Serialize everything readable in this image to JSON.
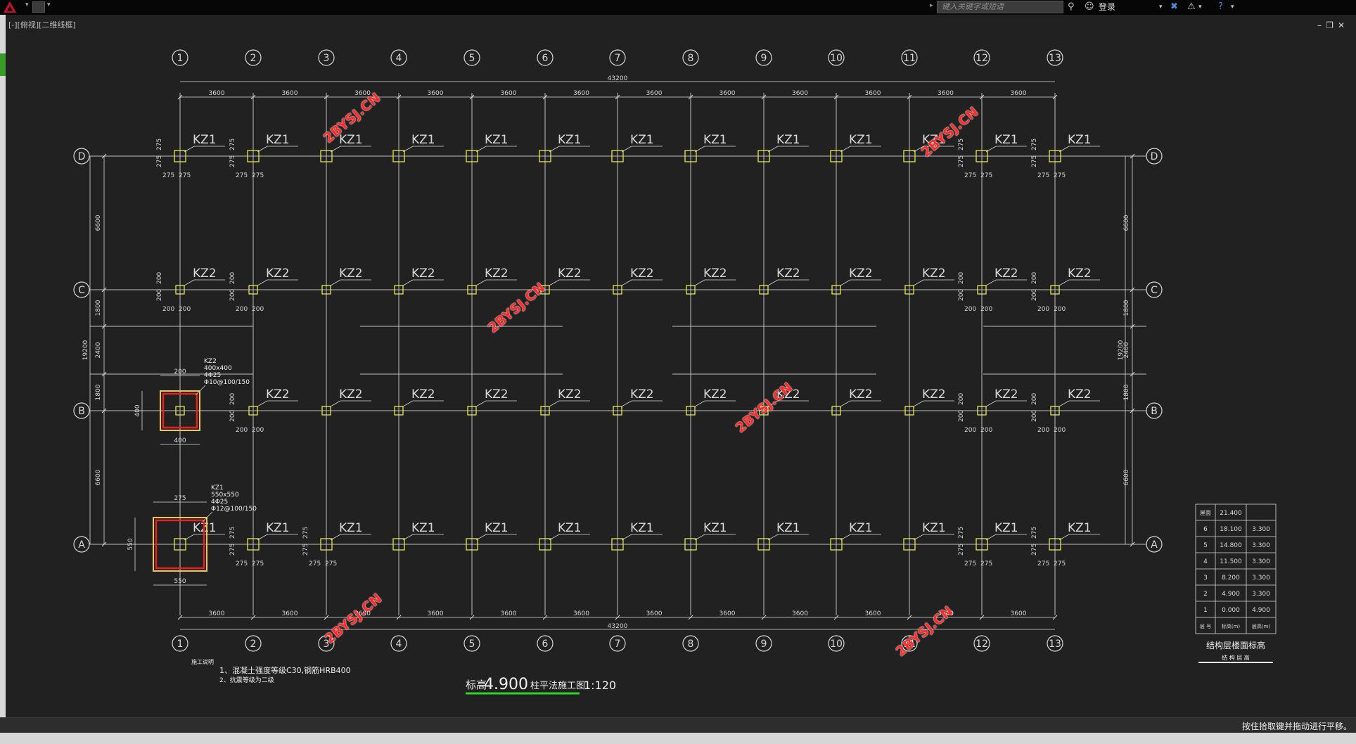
{
  "toolbar": {
    "search_placeholder": "键入关键字或短语",
    "login_label": "登录"
  },
  "viewport": {
    "label": "[-][俯视][二维线框]"
  },
  "status": {
    "message": "按住拾取键并拖动进行平移。"
  },
  "drawing": {
    "columns": [
      "1",
      "2",
      "3",
      "4",
      "5",
      "6",
      "7",
      "8",
      "9",
      "10",
      "11",
      "12",
      "13"
    ],
    "rows": [
      "D",
      "C",
      "B",
      "A"
    ],
    "total_span": "43200",
    "bay_top": [
      "3600",
      "3600",
      "3600",
      "3600",
      "3600",
      "3600",
      "3600",
      "3600",
      "3600",
      "3600",
      "3600",
      "3600"
    ],
    "bay_bottom": [
      "3600",
      "3600",
      "3600",
      "3600",
      "3600",
      "3600",
      "3600",
      "3600",
      "3600",
      "3600",
      "3600",
      "3600"
    ],
    "row_dims_left": [
      "6600",
      "1800",
      "2400",
      "1800",
      "6600"
    ],
    "total_depth": "19200",
    "kz1_label": "KZ1",
    "kz2_label": "KZ2",
    "offset_275": "275",
    "offset_200": "200",
    "detail_kz2": {
      "name": "KZ2",
      "size": "400x400",
      "rebar": "4Φ25",
      "stirrup": "Φ10@100/150",
      "dim_top": "200",
      "dim_side": "400",
      "dim_bottom": "400"
    },
    "detail_kz1": {
      "name": "KZ1",
      "size": "550x550",
      "rebar": "4Φ25",
      "stirrup": "Φ12@100/150",
      "dim_top": "275",
      "dim_side": "550",
      "dim_bottom": "550"
    },
    "notes_title": "施工说明",
    "notes": [
      "1、混凝土强度等级C30,钢筋HRB400",
      "2、抗震等级为二级"
    ],
    "title_prefix": "标高",
    "title_elev": "4.900",
    "title_suffix": "柱平法施工图",
    "title_scale": "1:120",
    "watermark": "2BYSJ.CN"
  },
  "floor_table": {
    "caption": "结构层楼面标高",
    "sub_caption": "结 构 层 高",
    "header": [
      "层 号",
      "标高(m)",
      "层高(m)"
    ],
    "roof": {
      "label": "屋面",
      "elev": "21.400"
    },
    "rows": [
      {
        "floor": "6",
        "elev": "18.100",
        "height": "3.300"
      },
      {
        "floor": "5",
        "elev": "14.800",
        "height": "3.300"
      },
      {
        "floor": "4",
        "elev": "11.500",
        "height": "3.300"
      },
      {
        "floor": "3",
        "elev": "8.200",
        "height": "3.300"
      },
      {
        "floor": "2",
        "elev": "4.900",
        "height": "3.300"
      },
      {
        "floor": "1",
        "elev": "0.000",
        "height": "4.900"
      }
    ]
  }
}
